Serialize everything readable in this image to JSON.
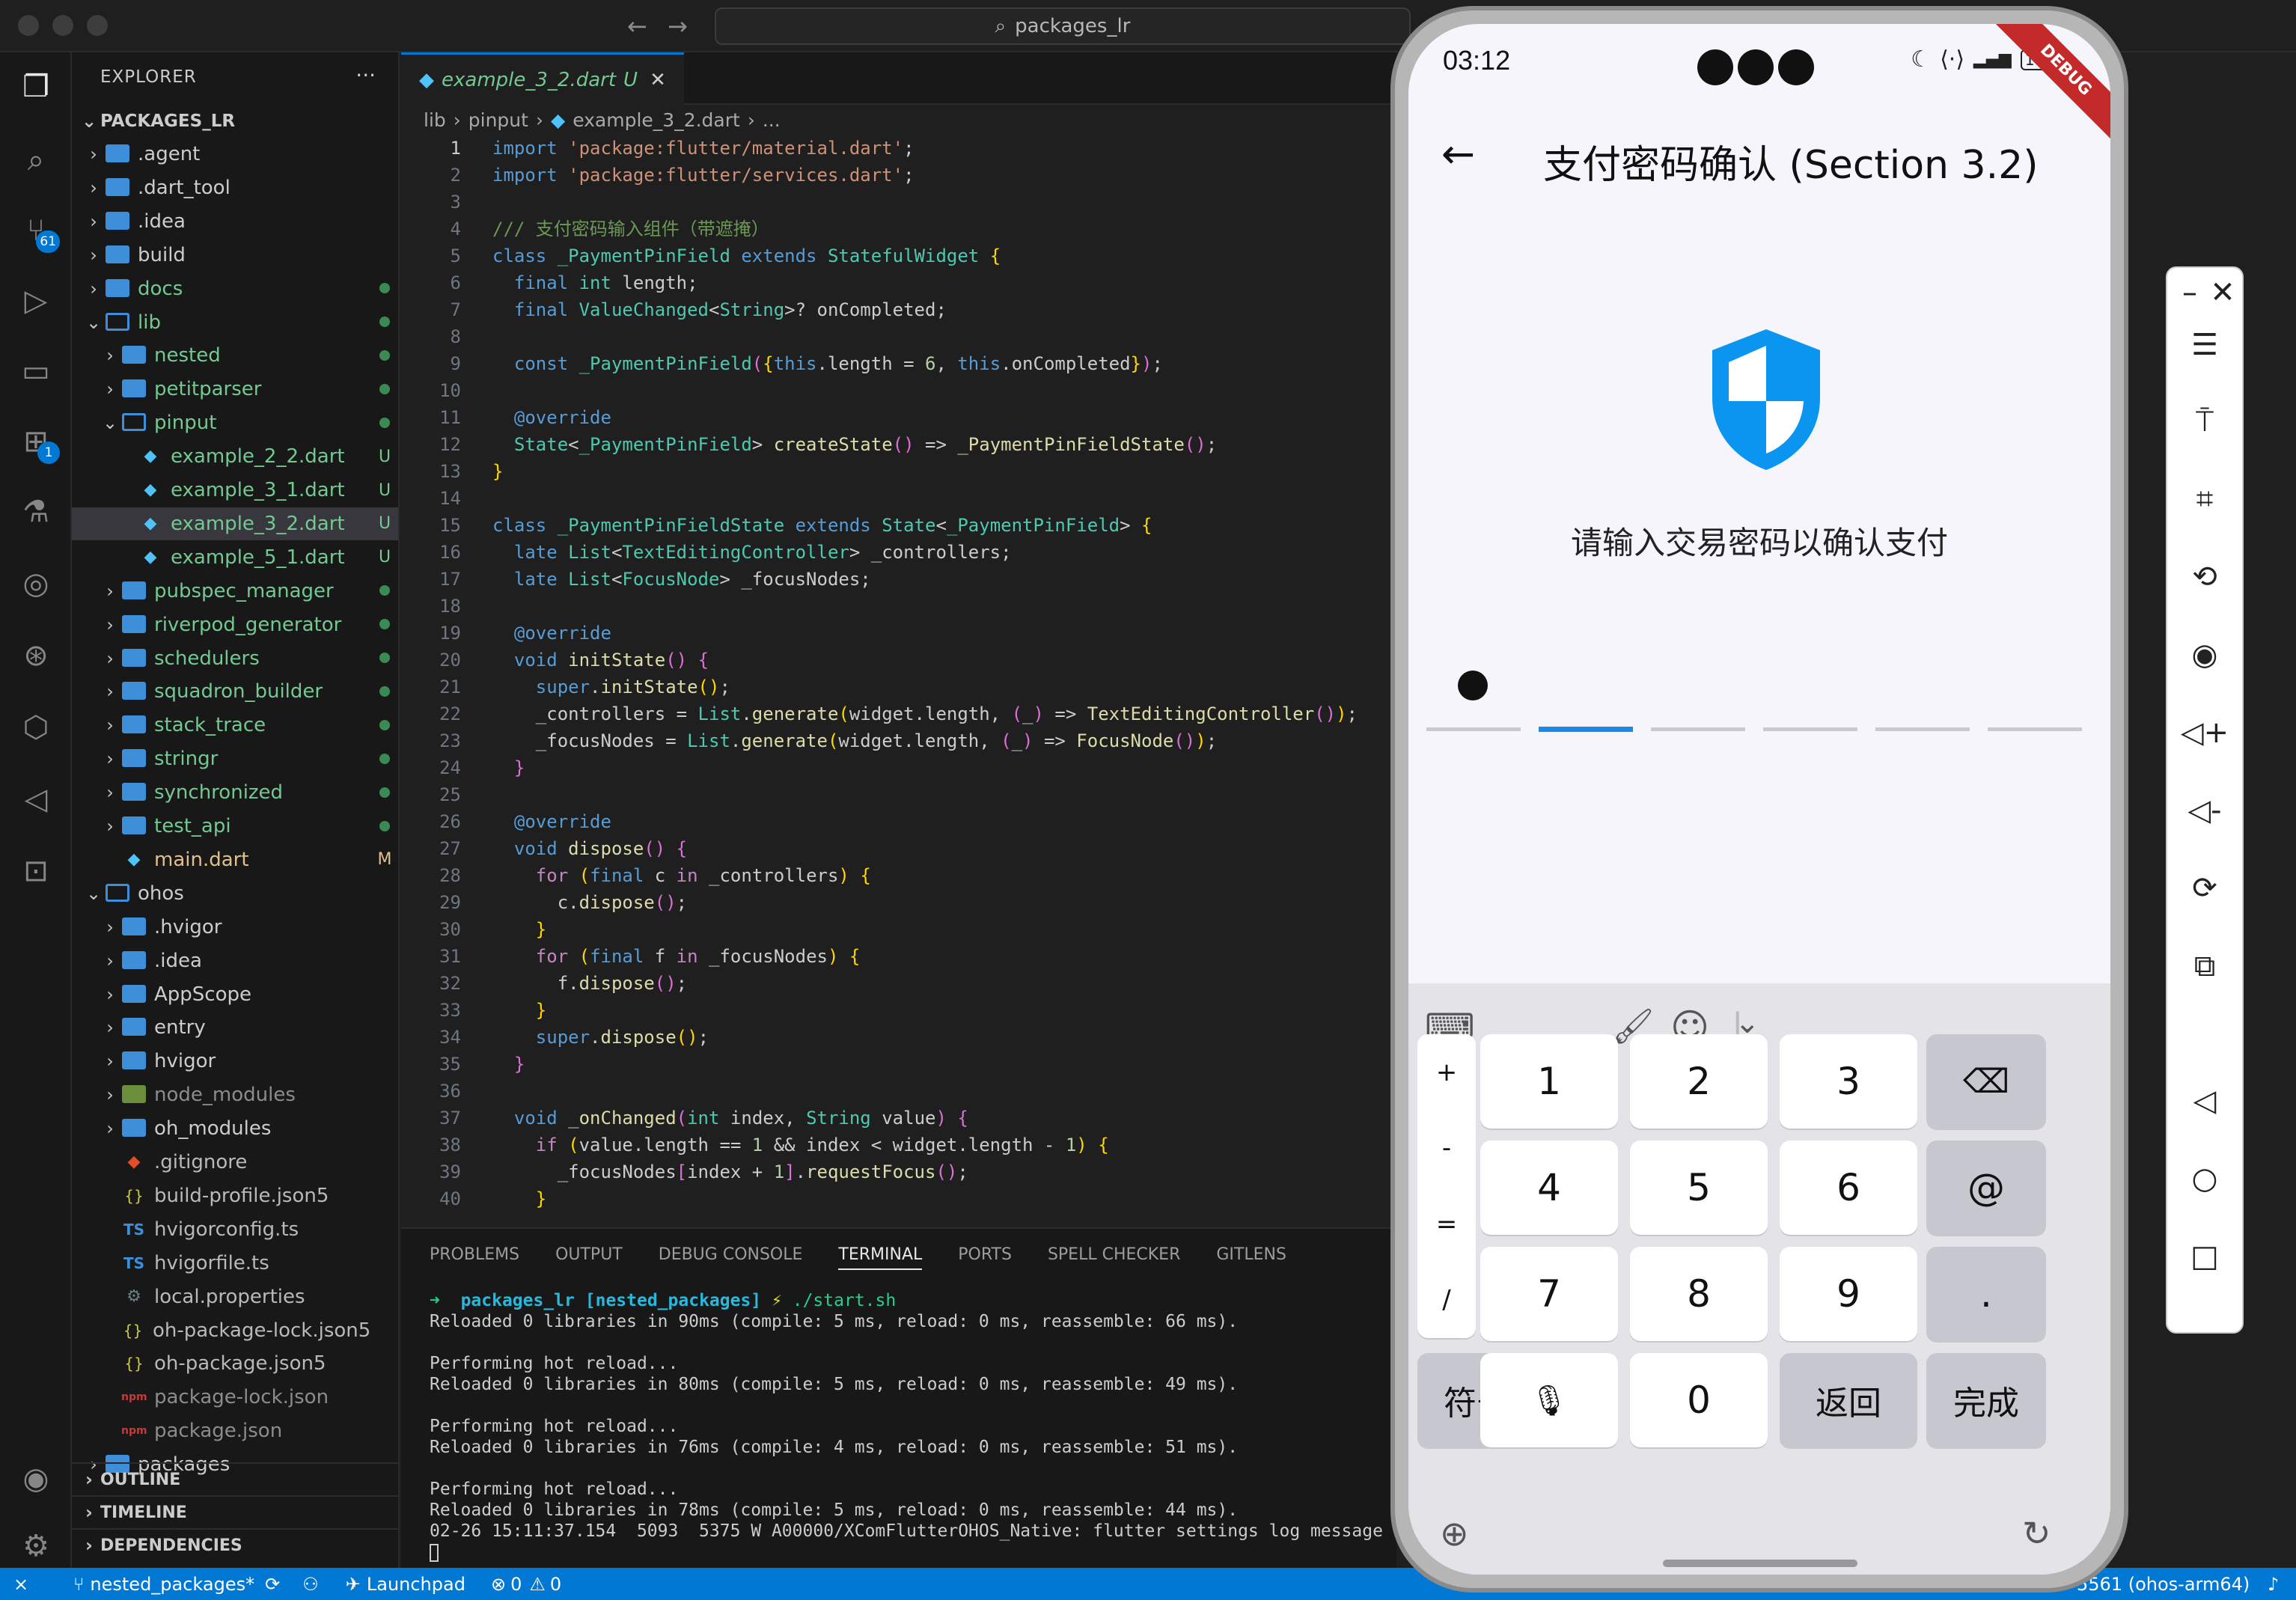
{
  "window": {
    "search_text": "packages_lr"
  },
  "activity_badges": {
    "scm": "61",
    "extensions": "1"
  },
  "explorer": {
    "title": "EXPLORER",
    "root": "PACKAGES_LR",
    "items": [
      {
        "name": ".agent",
        "depth": 0,
        "type": "folder",
        "open": false,
        "status": ""
      },
      {
        "name": ".dart_tool",
        "depth": 0,
        "type": "folder",
        "open": false,
        "status": ""
      },
      {
        "name": ".idea",
        "depth": 0,
        "type": "folder",
        "open": false,
        "status": ""
      },
      {
        "name": "build",
        "depth": 0,
        "type": "folder",
        "open": false,
        "status": ""
      },
      {
        "name": "docs",
        "depth": 0,
        "type": "folder",
        "open": false,
        "status": "dot"
      },
      {
        "name": "lib",
        "depth": 0,
        "type": "folder",
        "open": true,
        "status": "dot"
      },
      {
        "name": "nested",
        "depth": 1,
        "type": "folder",
        "open": false,
        "status": "dot"
      },
      {
        "name": "petitparser",
        "depth": 1,
        "type": "folder",
        "open": false,
        "status": "dot"
      },
      {
        "name": "pinput",
        "depth": 1,
        "type": "folder",
        "open": true,
        "status": "dot"
      },
      {
        "name": "example_2_2.dart",
        "depth": 2,
        "type": "dart",
        "status": "U"
      },
      {
        "name": "example_3_1.dart",
        "depth": 2,
        "type": "dart",
        "status": "U"
      },
      {
        "name": "example_3_2.dart",
        "depth": 2,
        "type": "dart",
        "status": "U",
        "selected": true
      },
      {
        "name": "example_5_1.dart",
        "depth": 2,
        "type": "dart",
        "status": "U"
      },
      {
        "name": "pubspec_manager",
        "depth": 1,
        "type": "folder",
        "open": false,
        "status": "dot"
      },
      {
        "name": "riverpod_generator",
        "depth": 1,
        "type": "folder",
        "open": false,
        "status": "dot"
      },
      {
        "name": "schedulers",
        "depth": 1,
        "type": "folder",
        "open": false,
        "status": "dot"
      },
      {
        "name": "squadron_builder",
        "depth": 1,
        "type": "folder",
        "open": false,
        "status": "dot"
      },
      {
        "name": "stack_trace",
        "depth": 1,
        "type": "folder",
        "open": false,
        "status": "dot"
      },
      {
        "name": "stringr",
        "depth": 1,
        "type": "folder",
        "open": false,
        "status": "dot"
      },
      {
        "name": "synchronized",
        "depth": 1,
        "type": "folder",
        "open": false,
        "status": "dot"
      },
      {
        "name": "test_api",
        "depth": 1,
        "type": "folder",
        "open": false,
        "status": "dot"
      },
      {
        "name": "main.dart",
        "depth": 1,
        "type": "dart",
        "status": "M"
      },
      {
        "name": "ohos",
        "depth": 0,
        "type": "folder",
        "open": true,
        "status": ""
      },
      {
        "name": ".hvigor",
        "depth": 1,
        "type": "folder",
        "open": false,
        "status": ""
      },
      {
        "name": ".idea",
        "depth": 1,
        "type": "folder",
        "open": false,
        "status": ""
      },
      {
        "name": "AppScope",
        "depth": 1,
        "type": "folder",
        "open": false,
        "status": ""
      },
      {
        "name": "entry",
        "depth": 1,
        "type": "folder",
        "open": false,
        "status": ""
      },
      {
        "name": "hvigor",
        "depth": 1,
        "type": "folder",
        "open": false,
        "status": ""
      },
      {
        "name": "node_modules",
        "depth": 1,
        "type": "folder-green",
        "open": false,
        "status": ""
      },
      {
        "name": "oh_modules",
        "depth": 1,
        "type": "folder",
        "open": false,
        "status": ""
      },
      {
        "name": ".gitignore",
        "depth": 1,
        "type": "git",
        "status": ""
      },
      {
        "name": "build-profile.json5",
        "depth": 1,
        "type": "json",
        "status": ""
      },
      {
        "name": "hvigorconfig.ts",
        "depth": 1,
        "type": "ts",
        "status": ""
      },
      {
        "name": "hvigorfile.ts",
        "depth": 1,
        "type": "ts",
        "status": ""
      },
      {
        "name": "local.properties",
        "depth": 1,
        "type": "gear",
        "status": ""
      },
      {
        "name": "oh-package-lock.json5",
        "depth": 1,
        "type": "json",
        "status": ""
      },
      {
        "name": "oh-package.json5",
        "depth": 1,
        "type": "json",
        "status": ""
      },
      {
        "name": "package-lock.json",
        "depth": 1,
        "type": "npm",
        "status": ""
      },
      {
        "name": "package.json",
        "depth": 1,
        "type": "npm",
        "status": ""
      },
      {
        "name": "packages",
        "depth": 0,
        "type": "folder",
        "open": false,
        "status": ""
      }
    ],
    "sections": [
      "OUTLINE",
      "TIMELINE",
      "DEPENDENCIES"
    ]
  },
  "editor": {
    "tab_label": "example_3_2.dart",
    "tab_status": "U",
    "breadcrumb": [
      "lib",
      "pinput",
      "example_3_2.dart",
      "..."
    ],
    "current_line": 1
  },
  "panel": {
    "tabs": [
      "PROBLEMS",
      "OUTPUT",
      "DEBUG CONSOLE",
      "TERMINAL",
      "PORTS",
      "SPELL CHECKER",
      "GITLENS"
    ],
    "active_tab": "TERMINAL",
    "prompt_dir": "packages_lr",
    "prompt_branch": "[nested_packages]",
    "prompt_cmd": "./start.sh",
    "output": [
      "Reloaded 0 libraries in 90ms (compile: 5 ms, reload: 0 ms, reassemble: 66 ms).",
      "",
      "Performing hot reload...",
      "Reloaded 0 libraries in 80ms (compile: 5 ms, reload: 0 ms, reassemble: 49 ms).",
      "",
      "Performing hot reload...",
      "Reloaded 0 libraries in 76ms (compile: 4 ms, reload: 0 ms, reassemble: 51 ms).",
      "",
      "Performing hot reload...",
      "Reloaded 0 libraries in 78ms (compile: 5 ms, reload: 0 ms, reassemble: 44 ms).",
      "02-26 15:11:37.154  5093  5375 W A00000/XComFlutterOHOS_Native: flutter settings log message"
    ]
  },
  "statusbar": {
    "branch": "nested_packages*",
    "launchpad": "Launchpad",
    "errors": "0",
    "warnings": "0",
    "device": "5561 (ohos-arm64)"
  },
  "phone": {
    "time": "03:12",
    "battery": "100",
    "debug_banner": "DEBUG",
    "app_title": "支付密码确认 (Section 3.2)",
    "prompt": "请输入交易密码以确认支付",
    "pin_length": 6,
    "pin_filled": 1,
    "keyboard": {
      "side_keys": [
        "+",
        "-",
        "=",
        "/"
      ],
      "digits": [
        "1",
        "2",
        "3",
        "4",
        "5",
        "6",
        "7",
        "8",
        "9"
      ],
      "right_keys": [
        "@",
        "."
      ],
      "symbols": "符号",
      "zero": "0",
      "return": "返回",
      "done": "完成"
    }
  },
  "colors": {
    "accent": "#0078d4",
    "pin_active": "#1e88e5",
    "shield": "#0a96f0"
  }
}
